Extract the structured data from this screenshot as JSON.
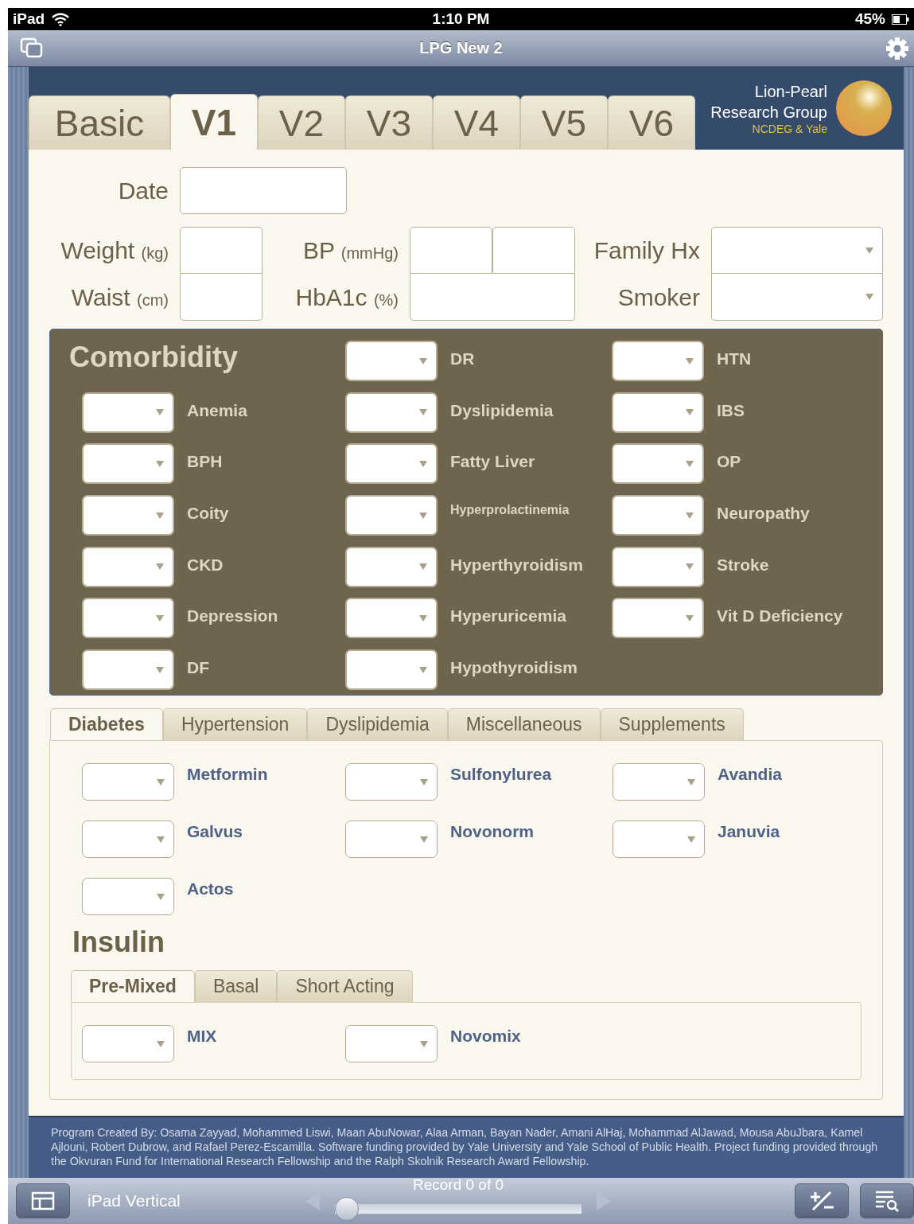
{
  "status_bar": {
    "device": "iPad",
    "time": "1:10 PM",
    "battery": "45%"
  },
  "nav_bar": {
    "title": "LPG New 2"
  },
  "visit_tabs": [
    {
      "label": "Basic",
      "selected": false
    },
    {
      "label": "V1",
      "selected": true
    },
    {
      "label": "V2",
      "selected": false
    },
    {
      "label": "V3",
      "selected": false
    },
    {
      "label": "V4",
      "selected": false
    },
    {
      "label": "V5",
      "selected": false
    },
    {
      "label": "V6",
      "selected": false
    }
  ],
  "brand": {
    "name_line_1": "Lion-Pearl",
    "name_line_2": "Research Group",
    "subtitle": "NCDEG & Yale"
  },
  "date": {
    "label": "Date"
  },
  "measures": [
    {
      "label": "Weight",
      "unit": "(kg)"
    },
    {
      "label": "Waist",
      "unit": "(cm)"
    }
  ],
  "vitals": [
    {
      "label": "BP",
      "unit": "(mmHg)"
    },
    {
      "label": "HbA1c",
      "unit": "(%)"
    }
  ],
  "history": [
    {
      "label": "Family Hx"
    },
    {
      "label": "Smoker"
    }
  ],
  "comorbidity": {
    "title": "Comorbidity",
    "columns": [
      [
        "Anemia",
        "BPH",
        "Coity",
        "CKD",
        "Depression",
        "DF"
      ],
      [
        "DR",
        "Dyslipidemia",
        "Fatty Liver",
        "Hyperprolactinemia",
        "Hyperthyroidism",
        "Hyperuricemia",
        "Hypothyroidism"
      ],
      [
        "HTN",
        "IBS",
        "OP",
        "Neuropathy",
        "Stroke",
        "Vit D Deficiency"
      ]
    ]
  },
  "medication_tabs": [
    {
      "label": "Diabetes",
      "selected": true
    },
    {
      "label": "Hypertension",
      "selected": false
    },
    {
      "label": "Dyslipidemia",
      "selected": false
    },
    {
      "label": "Miscellaneous",
      "selected": false
    },
    {
      "label": "Supplements",
      "selected": false
    }
  ],
  "medications": [
    "Metformin",
    "Sulfonylurea",
    "Avandia",
    "Galvus",
    "Novonorm",
    "Januvia",
    "Actos"
  ],
  "insulin": {
    "title": "Insulin",
    "tabs": [
      {
        "label": "Pre-Mixed",
        "selected": true
      },
      {
        "label": "Basal",
        "selected": false
      },
      {
        "label": "Short Acting",
        "selected": false
      }
    ],
    "items": [
      "MIX",
      "Novomix"
    ]
  },
  "credits": "Program Created By: Osama Zayyad, Mohammed Liswi, Maan AbuNowar, Alaa Arman, Bayan Nader, Amani AlHaj, Mohammad AlJawad, Mousa AbuJbara, Kamel Ajlouni, Robert Dubrow, and Rafael Perez-Escamilla. Software funding provided by Yale University and Yale School of Public Health. Project funding provided through the Okvuran Fund for International Research Fellowship and the Ralph Skolnik Research Award Fellowship.",
  "toolbar": {
    "layout": "iPad Vertical",
    "record": "Record 0 of 0",
    "slider": {
      "level": 0
    }
  }
}
